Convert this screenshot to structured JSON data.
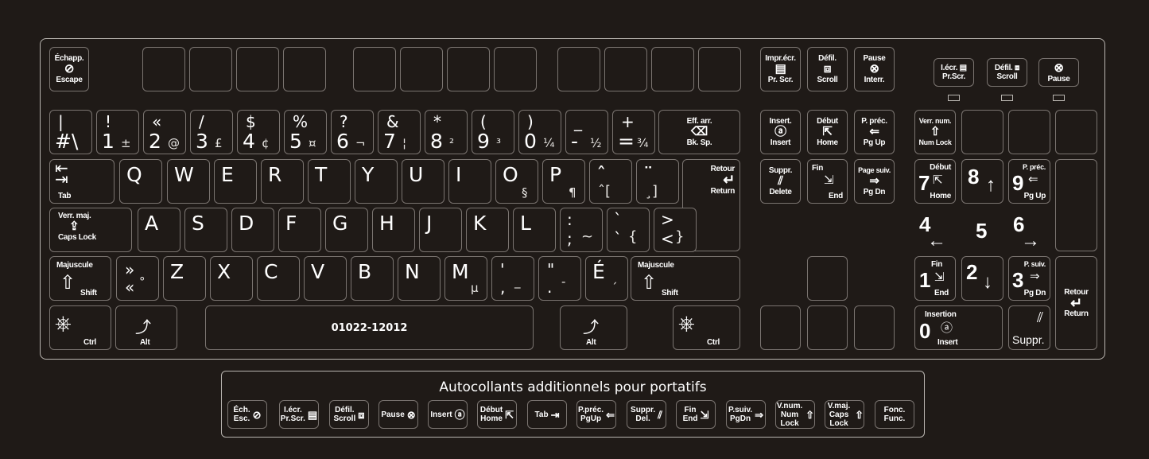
{
  "colors": {
    "background": "#1f1a17",
    "outline": "#b9b5b0",
    "key_border": "#7a7470",
    "text": "#ffffff"
  },
  "function_row": {
    "escape": {
      "fr": "Échapp.",
      "en": "Escape",
      "icon": "escape-icon"
    },
    "print_screen": {
      "fr": "Impr.écr.",
      "en": "Pr. Scr.",
      "icon": "print-screen-icon"
    },
    "scroll": {
      "fr": "Défil.",
      "en": "Scroll",
      "icon": "scroll-icon"
    },
    "pause": {
      "fr": "Pause",
      "en": "Interr.",
      "icon": "pause-icon"
    }
  },
  "number_row": [
    {
      "top": "|",
      "main": "#\\",
      "alt": ""
    },
    {
      "top": "!",
      "main": "1",
      "alt": "±"
    },
    {
      "top": "«",
      "main": "2",
      "alt": "@"
    },
    {
      "top": "/",
      "main": "3",
      "alt": "£"
    },
    {
      "top": "$",
      "main": "4",
      "alt": "¢"
    },
    {
      "top": "%",
      "main": "5",
      "alt": "¤"
    },
    {
      "top": "?",
      "main": "6",
      "alt": "¬"
    },
    {
      "top": "&",
      "main": "7",
      "alt": "¦"
    },
    {
      "top": "*",
      "main": "8",
      "alt": "²"
    },
    {
      "top": "(",
      "main": "9",
      "alt": "³"
    },
    {
      "top": ")",
      "main": "0",
      "alt": "¼"
    },
    {
      "top": "_",
      "main": "-",
      "alt": "½"
    },
    {
      "top": "+",
      "main": "=",
      "alt": "¾"
    }
  ],
  "backspace": {
    "fr": "Eff. arr.",
    "en": "Bk. Sp.",
    "icon": "backspace-icon"
  },
  "tab": {
    "en": "Tab",
    "icon": "tab-icon"
  },
  "qwerty_row": [
    {
      "main": "Q",
      "alt": ""
    },
    {
      "main": "W",
      "alt": ""
    },
    {
      "main": "E",
      "alt": ""
    },
    {
      "main": "R",
      "alt": ""
    },
    {
      "main": "T",
      "alt": ""
    },
    {
      "main": "Y",
      "alt": ""
    },
    {
      "main": "U",
      "alt": ""
    },
    {
      "main": "I",
      "alt": ""
    },
    {
      "main": "O",
      "alt": "§"
    },
    {
      "main": "P",
      "alt": "¶"
    },
    {
      "main": "ˆ",
      "sub": "ˆ[",
      "alt": ""
    },
    {
      "main": "¨",
      "sub": "¸]",
      "alt": ""
    }
  ],
  "return": {
    "fr": "Retour",
    "en": "Return",
    "icon": "return-arrow-icon"
  },
  "caps_lock": {
    "fr": "Verr. maj.",
    "en": "Caps Lock",
    "icon": "caps-lock-icon"
  },
  "asdf_row": [
    {
      "main": "A"
    },
    {
      "main": "S"
    },
    {
      "main": "D"
    },
    {
      "main": "F"
    },
    {
      "main": "G"
    },
    {
      "main": "H"
    },
    {
      "main": "J"
    },
    {
      "main": "K"
    },
    {
      "main": "L"
    },
    {
      "top": ":",
      "main": ";",
      "alt": "~"
    },
    {
      "top": "`",
      "main": "`",
      "alt": "{"
    },
    {
      "top": ">",
      "main": "<",
      "alt": "}"
    }
  ],
  "shift": {
    "fr": "Majuscule",
    "en": "Shift",
    "icon": "shift-arrow-icon"
  },
  "zxcv_row": [
    {
      "top": "»",
      "main": "«",
      "alt": "°"
    },
    {
      "main": "Z"
    },
    {
      "main": "X"
    },
    {
      "main": "C"
    },
    {
      "main": "V"
    },
    {
      "main": "B"
    },
    {
      "main": "N"
    },
    {
      "main": "M",
      "alt": "µ"
    },
    {
      "top": "'",
      "main": ",",
      "alt": "_"
    },
    {
      "top": "\"",
      "main": ".",
      "alt": "-"
    },
    {
      "main": "É",
      "alt": "´"
    }
  ],
  "bottom_row": {
    "ctrl": "Ctrl",
    "alt": "Alt",
    "space_label": "01022-12012"
  },
  "nav_cluster": {
    "insert": {
      "fr": "Insert.",
      "en": "Insert"
    },
    "home": {
      "fr": "Début",
      "en": "Home"
    },
    "page_up": {
      "fr": "P. préc.",
      "en": "Pg Up"
    },
    "delete": {
      "fr": "Suppr.",
      "en": "Delete"
    },
    "end": {
      "fr": "Fin",
      "en": "End"
    },
    "page_down": {
      "fr": "Page suiv.",
      "en": "Pg Dn"
    }
  },
  "indicator_keys": [
    {
      "fr": "I.écr.",
      "en": "Pr.Scr."
    },
    {
      "fr": "Défil.",
      "en": "Scroll"
    },
    {
      "fr": "",
      "en": "Pause"
    }
  ],
  "numpad": {
    "num_lock": {
      "fr": "Verr. num.",
      "en": "Num Lock"
    },
    "k7": {
      "num": "7",
      "fr": "Début",
      "en": "Home"
    },
    "k8": {
      "num": "8",
      "arrow": "↑"
    },
    "k9": {
      "num": "9",
      "fr": "P. préc.",
      "en": "Pg Up"
    },
    "k4": {
      "num": "4",
      "arrow": "←"
    },
    "k5": {
      "num": "5"
    },
    "k6": {
      "num": "6",
      "arrow": "→"
    },
    "k1": {
      "num": "1",
      "fr": "Fin",
      "en": "End"
    },
    "k2": {
      "num": "2",
      "arrow": "↓"
    },
    "k3": {
      "num": "3",
      "fr": "P. suiv.",
      "en": "Pg Dn"
    },
    "k0": {
      "num": "0",
      "fr": "Insertion",
      "en": "Insert"
    },
    "dot": {
      "label": "Suppr."
    },
    "enter": {
      "fr": "Retour",
      "en": "Return"
    }
  },
  "laptop_panel": {
    "title": "Autocollants additionnels pour portatifs",
    "stickers": [
      {
        "fr": "Éch.",
        "en": "Esc."
      },
      {
        "fr": "I.écr.",
        "en": "Pr.Scr."
      },
      {
        "fr": "Défil.",
        "en": "Scroll"
      },
      {
        "fr": "",
        "en": "Pause"
      },
      {
        "fr": "",
        "en": "Insert"
      },
      {
        "fr": "Début",
        "en": "Home"
      },
      {
        "fr": "",
        "en": "Tab"
      },
      {
        "fr": "P.préc.",
        "en": "PgUp"
      },
      {
        "fr": "Suppr.",
        "en": "Del."
      },
      {
        "fr": "Fin",
        "en": "End"
      },
      {
        "fr": "P.suiv.",
        "en": "PgDn"
      },
      {
        "fr": "V.num.",
        "en": "Num Lock"
      },
      {
        "fr": "V.maj.",
        "en": "Caps Lock"
      },
      {
        "fr": "Fonc.",
        "en": "Func."
      }
    ]
  }
}
